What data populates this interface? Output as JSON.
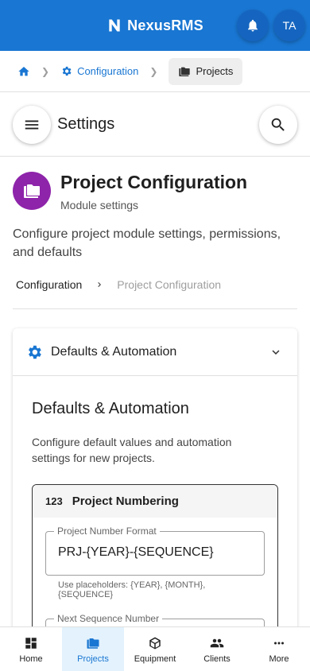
{
  "app": {
    "brand": "NexusRMS",
    "avatar_initials": "TA"
  },
  "breadcrumb": {
    "configuration": "Configuration",
    "current": "Projects"
  },
  "settings": {
    "title": "Settings"
  },
  "page": {
    "title": "Project Configuration",
    "subtitle": "Module settings",
    "description": "Configure project module settings, permissions, and defaults"
  },
  "sub_breadcrumb": {
    "first": "Configuration",
    "last": "Project Configuration"
  },
  "accordion": {
    "title": "Defaults & Automation",
    "section_title": "Defaults & Automation",
    "section_desc": "Configure default values and automation settings for new projects."
  },
  "numbering": {
    "icon_text": "123",
    "title": "Project Numbering",
    "format_label": "Project Number Format",
    "format_value": "PRJ-{YEAR}-{SEQUENCE}",
    "helper": "Use placeholders: {YEAR}, {MONTH}, {SEQUENCE}",
    "next_label": "Next Sequence Number"
  },
  "bottom_nav": [
    {
      "label": "Home",
      "icon": "dashboard-icon"
    },
    {
      "label": "Projects",
      "icon": "folder-icon",
      "active": true
    },
    {
      "label": "Equipment",
      "icon": "cube-icon"
    },
    {
      "label": "Clients",
      "icon": "people-icon"
    },
    {
      "label": "More",
      "icon": "more-icon"
    }
  ],
  "colors": {
    "primary": "#1976d2",
    "avatar_purple": "#8e24aa",
    "active_nav_bg": "#e3f2fd"
  }
}
